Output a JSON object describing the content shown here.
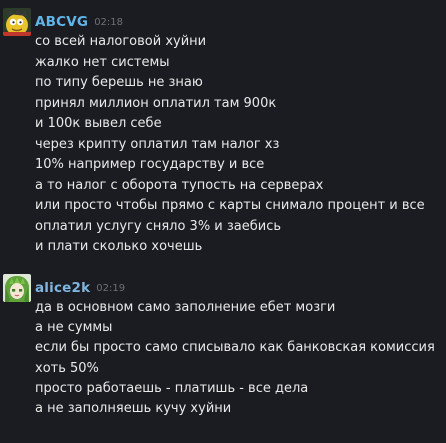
{
  "theme": {
    "background": "#1b1c21",
    "text": "#e9e9e9",
    "timestamp": "#6d6f76"
  },
  "messages": [
    {
      "author": "ABCVG",
      "author_color": "#5fb6ea",
      "time": "02:18",
      "avatar_icon": "yellow-cartoon-character-avatar",
      "lines": [
        "со всей налоговой хуйни",
        "жалко нет системы",
        "по типу берешь не знаю",
        "принял миллион оплатил там 900к",
        "и 100к вывел себе",
        "через крипту оплатил там налог хз",
        "10% например государству и все",
        "а то налог с оборота тупость на серверах",
        "или просто чтобы прямо с карты снимало процент и все",
        "оплатил услугу сняло 3% и заебись",
        "и плати сколько хочешь"
      ]
    },
    {
      "author": "alice2k",
      "author_color": "#7fb6e0",
      "time": "02:19",
      "avatar_icon": "green-anime-character-avatar",
      "lines": [
        "да в основном само заполнение ебет мозги",
        "а не суммы",
        "если бы просто само списывало как банковская комиссия",
        "хоть 50%",
        "просто работаешь - платишь - все дела",
        "а не заполняешь кучу хуйни"
      ]
    }
  ]
}
